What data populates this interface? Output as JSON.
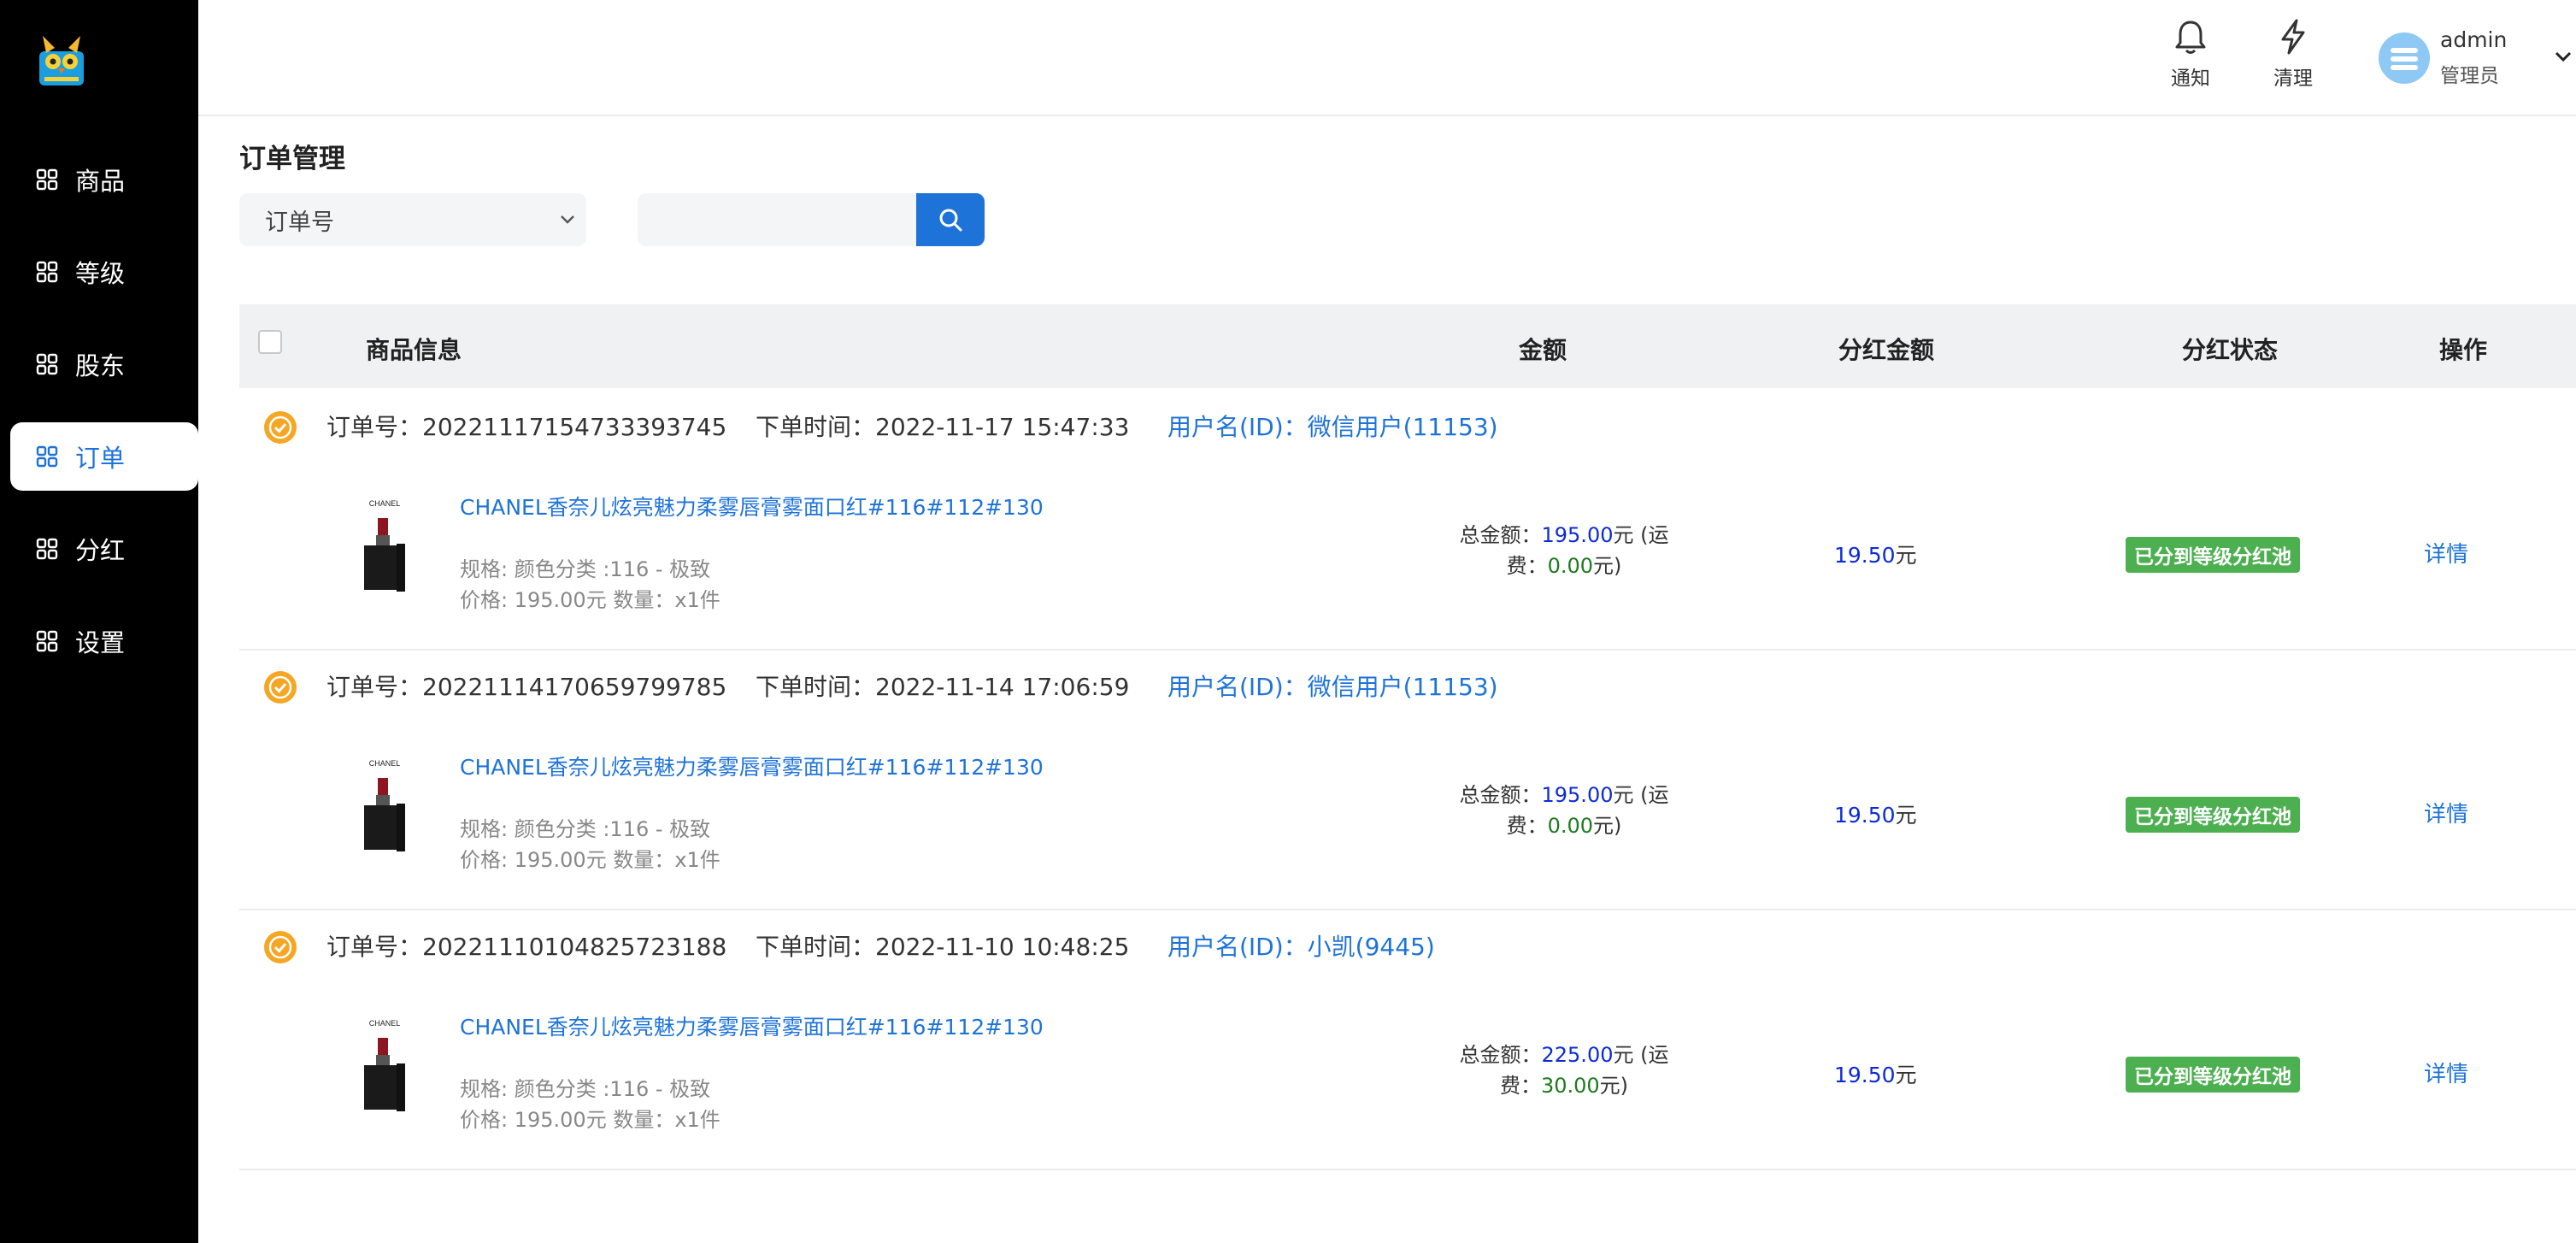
{
  "sidebar": {
    "items": [
      {
        "label": "商品"
      },
      {
        "label": "等级"
      },
      {
        "label": "股东"
      },
      {
        "label": "订单"
      },
      {
        "label": "分红"
      },
      {
        "label": "设置"
      }
    ],
    "active": "订单"
  },
  "header": {
    "notify_label": "通知",
    "clear_label": "清理",
    "username": "admin",
    "role": "管理员"
  },
  "page": {
    "title": "订单管理",
    "search": {
      "field_selected": "订单号",
      "value": "",
      "placeholder": ""
    }
  },
  "table": {
    "headers": {
      "product": "商品信息",
      "amount": "金额",
      "dividend_amount": "分红金额",
      "dividend_status": "分红状态",
      "action": "操作"
    },
    "orders": [
      {
        "order_no": "订单号：20221117154733393745",
        "order_time": "下单时间：2022-11-17 15:47:33",
        "user": "用户名(ID)：微信用户(11153)",
        "product_title": "CHANEL香奈儿炫亮魅力柔雾唇膏雾面口红#116#112#130",
        "spec": "规格:   颜色分类 :116 - 极致",
        "price": "价格:  195.00元     数量：x1件",
        "total_label": "总金额：",
        "total_value": "195.00",
        "total_suffix": "元 (运",
        "ship_label": "费：",
        "ship_value": "0.00",
        "ship_suffix": "元)",
        "dividend_value": "19.50",
        "dividend_suffix": "元",
        "status": "已分到等级分红池",
        "detail": "详情"
      },
      {
        "order_no": "订单号：20221114170659799785",
        "order_time": "下单时间：2022-11-14 17:06:59",
        "user": "用户名(ID)：微信用户(11153)",
        "product_title": "CHANEL香奈儿炫亮魅力柔雾唇膏雾面口红#116#112#130",
        "spec": "规格:   颜色分类 :116 - 极致",
        "price": "价格:  195.00元     数量：x1件",
        "total_label": "总金额：",
        "total_value": "195.00",
        "total_suffix": "元 (运",
        "ship_label": "费：",
        "ship_value": "0.00",
        "ship_suffix": "元)",
        "dividend_value": "19.50",
        "dividend_suffix": "元",
        "status": "已分到等级分红池",
        "detail": "详情"
      },
      {
        "order_no": "订单号：20221110104825723188",
        "order_time": "下单时间：2022-11-10 10:48:25",
        "user": "用户名(ID)：小凯(9445)",
        "product_title": "CHANEL香奈儿炫亮魅力柔雾唇膏雾面口红#116#112#130",
        "spec": "规格:   颜色分类 :116 - 极致",
        "price": "价格:  195.00元     数量：x1件",
        "total_label": "总金额：",
        "total_value": "225.00",
        "total_suffix": "元 (运",
        "ship_label": "费：",
        "ship_value": "30.00",
        "ship_suffix": "元)",
        "dividend_value": "19.50",
        "dividend_suffix": "元",
        "status": "已分到等级分红池",
        "detail": "详情"
      }
    ],
    "product_brand": "CHANEL"
  },
  "colors": {
    "accent": "#1e73d8",
    "sidebar_bg": "#000000",
    "status_green": "#4caf50",
    "badge_orange": "#f5a623"
  }
}
